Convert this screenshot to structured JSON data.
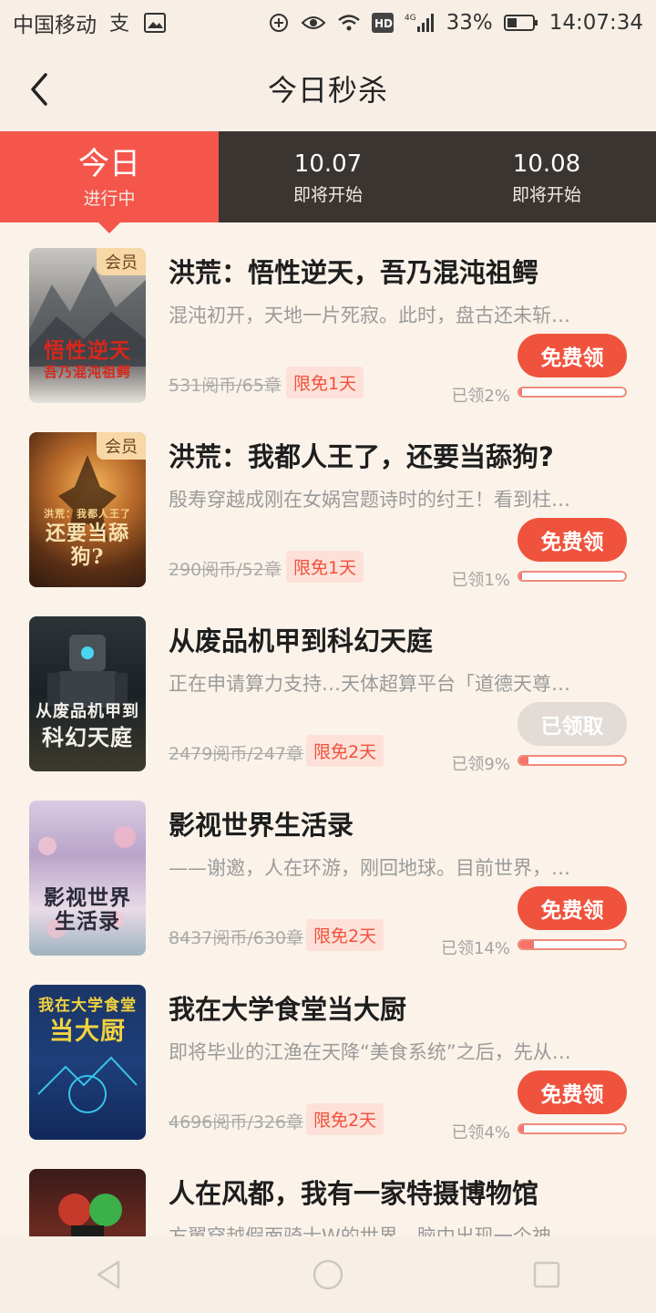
{
  "status_bar": {
    "carrier": "中国移动",
    "battery": "33%",
    "time": "14:07:34",
    "network": "4G",
    "hd": "HD"
  },
  "header": {
    "title": "今日秒杀"
  },
  "tabs": [
    {
      "main": "今日",
      "sub": "进行中",
      "active": true
    },
    {
      "main": "10.07",
      "sub": "即将开始",
      "active": false
    },
    {
      "main": "10.08",
      "sub": "即将开始",
      "active": false
    }
  ],
  "books": [
    {
      "title": "洪荒：悟性逆天，吾乃混沌祖鳄",
      "desc": "混沌初开，天地一片死寂。此时，盘古还未斩…",
      "price": "531阅币/65章",
      "free_tag": "限免1天",
      "button": "免费领",
      "claimed": "已领2%",
      "claimed_fraction": 0.02,
      "member": "会员",
      "cover_line1": "悟性逆天",
      "cover_line2": "吾乃混沌祖鳄"
    },
    {
      "title": "洪荒：我都人王了，还要当舔狗?",
      "desc": "殷寿穿越成刚在女娲宫题诗时的纣王！看到柱…",
      "price": "290阅币/52章",
      "free_tag": "限免1天",
      "button": "免费领",
      "claimed": "已领1%",
      "claimed_fraction": 0.01,
      "member": "会员",
      "cover_line1": "洪荒：我都人王了",
      "cover_line2": "还要当舔狗?"
    },
    {
      "title": "从废品机甲到科幻天庭",
      "desc": "正在申请算力支持…天体超算平台「道德天尊…",
      "price": "2479阅币/247章",
      "free_tag": "限免2天",
      "button": "已领取",
      "claimed": "已领9%",
      "claimed_fraction": 0.09,
      "member": "",
      "cover_line1": "从废品机甲到",
      "cover_line2": "科幻天庭"
    },
    {
      "title": "影视世界生活录",
      "desc": "——谢邀，人在环游，刚回地球。目前世界，…",
      "price": "8437阅币/630章",
      "free_tag": "限免2天",
      "button": "免费领",
      "claimed": "已领14%",
      "claimed_fraction": 0.14,
      "member": "",
      "cover_line1": "影视世界",
      "cover_line2": "生活录"
    },
    {
      "title": "我在大学食堂当大厨",
      "desc": "即将毕业的江渔在天降“美食系统”之后，先从…",
      "price": "4696阅币/326章",
      "free_tag": "限免2天",
      "button": "免费领",
      "claimed": "已领4%",
      "claimed_fraction": 0.04,
      "member": "",
      "cover_line1": "我在大学食堂",
      "cover_line2": "当大厨"
    },
    {
      "title": "人在风都，我有一家特摄博物馆",
      "desc": "方翼穿越假面骑士W的世界，脑中出现一个神…",
      "price": "",
      "free_tag": "",
      "button": "",
      "claimed": "",
      "claimed_fraction": 0,
      "member": "",
      "cover_line1": "",
      "cover_line2": ""
    }
  ],
  "colors": {
    "accent": "#f4564b",
    "tab_bg": "#3b3532",
    "page_bg": "#fbf3ea",
    "button": "#f0533d",
    "button_disabled": "#e2dbd6"
  }
}
